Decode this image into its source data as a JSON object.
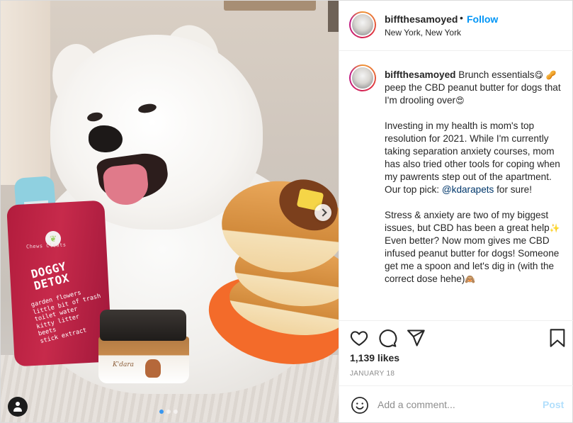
{
  "header": {
    "username": "biffthesamoyed",
    "separator": "•",
    "follow_label": "Follow",
    "location": "New York, New York"
  },
  "media": {
    "bottle_brand": "Chews  Cleats",
    "bottle_title": "DOGGY\nDETOX",
    "bottle_list": "garden flowers\nlittle bit of trash\ntoilet water\nkitty litter\nbeets\nstick extract",
    "jar_brand": "K'dara",
    "carousel_dots": 3,
    "active_dot": 1
  },
  "caption": {
    "username": "biffthesamoyed",
    "p1_text": "Brunch essentials",
    "p1_emoji1": "😋",
    "p1_emoji2": "🥜",
    "p1_rest": "peep the CBD peanut butter for dogs that I'm drooling over",
    "p1_emoji3": "😍",
    "p2_text": "Investing in my health is mom's top resolution for 2021. While I'm currently taking separation anxiety courses, mom has also tried other tools for coping when my pawrents step out of the apartment. Our top pick:",
    "p2_mention": "@kdarapets",
    "p2_end": "for sure!",
    "p3_text": "Stress & anxiety are two of my biggest issues, but CBD has been a great help",
    "p3_emoji1": "✨",
    "p3_rest": "Even better? Now mom gives me CBD infused peanut butter for dogs! Someone get me a spoon and let's dig in (with the correct dose hehe)",
    "p3_emoji2": "🙈"
  },
  "actions": {
    "likes": "1,139 likes",
    "date": "JANUARY 18"
  },
  "comment_box": {
    "placeholder": "Add a comment...",
    "post_label": "Post"
  },
  "icons": {
    "like": "heart-icon",
    "comment": "comment-icon",
    "share": "share-icon",
    "save": "bookmark-icon",
    "emoji": "smiley-icon",
    "next": "chevron-right-icon",
    "tags": "user-tag-icon"
  },
  "colors": {
    "follow": "#0095f6",
    "post_disabled": "#b2dffc",
    "active_dot": "#3897f0",
    "mention": "#00376b"
  }
}
